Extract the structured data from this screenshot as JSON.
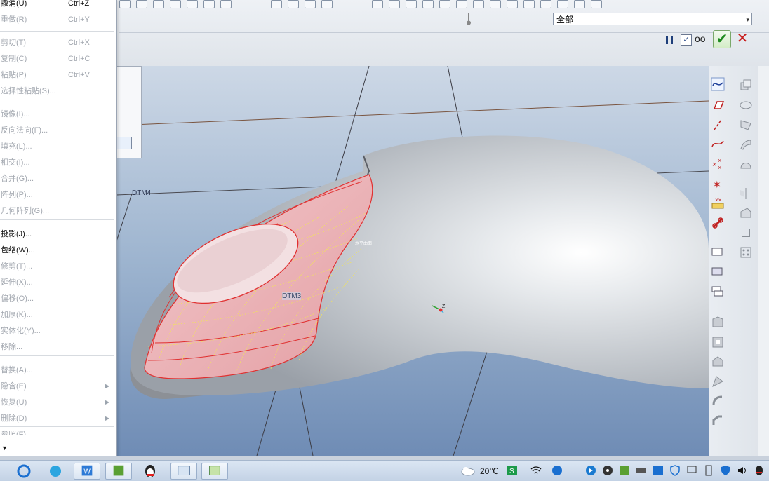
{
  "menu": {
    "items": [
      {
        "label": "撤消(U)",
        "shortcut": "Ctrl+Z",
        "enabled": true
      },
      {
        "label": "重做(R)",
        "shortcut": "Ctrl+Y",
        "enabled": false
      },
      {
        "label": "剪切(T)",
        "shortcut": "Ctrl+X",
        "enabled": false
      },
      {
        "label": "复制(C)",
        "shortcut": "Ctrl+C",
        "enabled": false
      },
      {
        "label": "粘贴(P)",
        "shortcut": "Ctrl+V",
        "enabled": false
      },
      {
        "label": "选择性粘贴(S)...",
        "shortcut": "",
        "enabled": false
      },
      {
        "label": "镜像(I)...",
        "shortcut": "",
        "enabled": false
      },
      {
        "label": "反向法向(F)...",
        "shortcut": "",
        "enabled": false
      },
      {
        "label": "填充(L)...",
        "shortcut": "",
        "enabled": false
      },
      {
        "label": "相交(I)...",
        "shortcut": "",
        "enabled": false
      },
      {
        "label": "合并(G)...",
        "shortcut": "",
        "enabled": false
      },
      {
        "label": "阵列(P)...",
        "shortcut": "",
        "enabled": false
      },
      {
        "label": "几何阵列(G)...",
        "shortcut": "",
        "enabled": false
      },
      {
        "label": "投影(J)...",
        "shortcut": "",
        "enabled": true
      },
      {
        "label": "包络(W)...",
        "shortcut": "",
        "enabled": true
      },
      {
        "label": "修剪(T)...",
        "shortcut": "",
        "enabled": false
      },
      {
        "label": "延伸(X)...",
        "shortcut": "",
        "enabled": false
      },
      {
        "label": "偏移(O)...",
        "shortcut": "",
        "enabled": false
      },
      {
        "label": "加厚(K)...",
        "shortcut": "",
        "enabled": false
      },
      {
        "label": "实体化(Y)...",
        "shortcut": "",
        "enabled": false
      },
      {
        "label": "移除...",
        "shortcut": "",
        "enabled": false
      },
      {
        "label": "替换(A)...",
        "shortcut": "",
        "enabled": false
      },
      {
        "label": "隐含(E)",
        "shortcut": "",
        "enabled": false,
        "submenu": true
      },
      {
        "label": "恢复(U)",
        "shortcut": "",
        "enabled": false,
        "submenu": true
      },
      {
        "label": "删除(D)",
        "shortcut": "",
        "enabled": false,
        "submenu": true
      },
      {
        "label": "参照(F)",
        "shortcut": "",
        "enabled": false
      }
    ],
    "more_arrow": "▼"
  },
  "toolbar": {
    "filter_value": "全部",
    "filter_arrow": "▾",
    "pause_icon": "pause-icon",
    "check_label": "✓",
    "glasses_label": "oo",
    "ok_label": "✔",
    "cancel_label": "✕"
  },
  "viewport": {
    "datum_dtm4": "DTM4",
    "datum_dtm3": "DTM3",
    "surface_label": "水平曲面",
    "panel_button": ". ."
  },
  "taskbar": {
    "temperature": "20℃"
  },
  "colors": {
    "accent_green": "#1e8a1e",
    "cancel_red": "#c81e1e",
    "surface_red": "#e03030",
    "mesh_yellow": "#f2e45a",
    "model_grey": "#c8ccd0"
  }
}
